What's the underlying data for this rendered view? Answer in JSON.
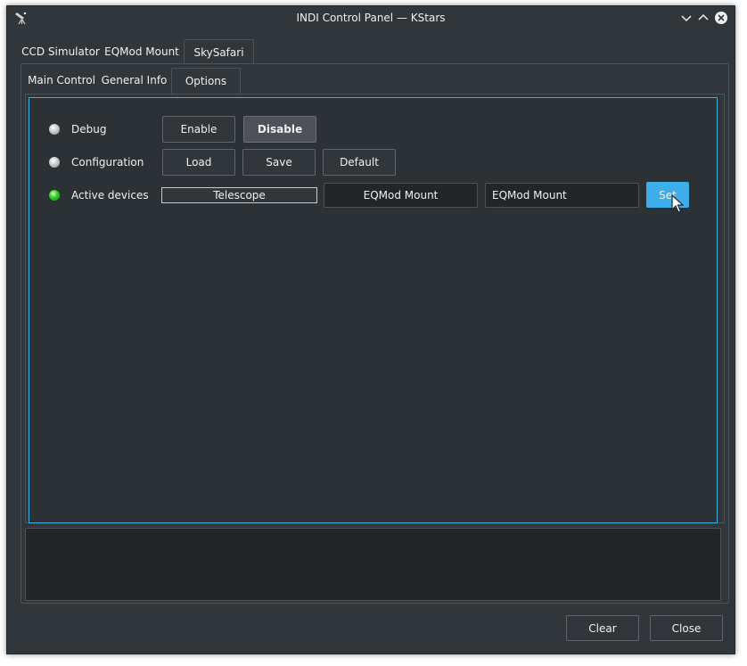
{
  "window": {
    "title": "INDI Control Panel — KStars",
    "controls": [
      "minimize-icon",
      "maximize-icon",
      "close-icon"
    ]
  },
  "device_tabs": [
    {
      "label": "CCD Simulator",
      "active": false
    },
    {
      "label": "EQMod Mount",
      "active": false
    },
    {
      "label": "SkySafari",
      "active": true
    }
  ],
  "group_tabs": [
    {
      "label": "Main Control",
      "active": false
    },
    {
      "label": "General Info",
      "active": false
    },
    {
      "label": "Options",
      "active": true
    }
  ],
  "properties": {
    "debug": {
      "label": "Debug",
      "state": "idle",
      "enable_label": "Enable",
      "disable_label": "Disable",
      "selected": "Disable"
    },
    "configuration": {
      "label": "Configuration",
      "state": "idle",
      "load_label": "Load",
      "save_label": "Save",
      "default_label": "Default"
    },
    "active_devices": {
      "label": "Active devices",
      "state": "ok",
      "element_label": "Telescope",
      "current_value": "EQMod Mount",
      "input_value": "EQMod Mount",
      "set_label": "Set"
    }
  },
  "log": {
    "text": ""
  },
  "footer": {
    "clear_label": "Clear",
    "close_label": "Close"
  },
  "colors": {
    "background": "#31363b",
    "accent": "#3daee9",
    "led_ok": "#34d224",
    "led_idle": "#d4d4d4"
  }
}
